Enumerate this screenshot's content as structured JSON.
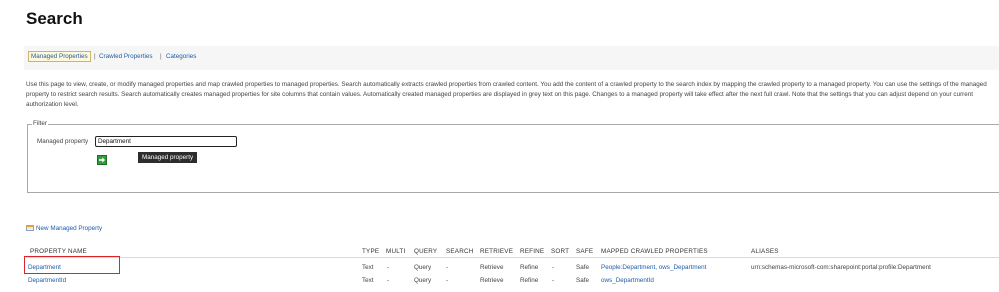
{
  "page": {
    "title": "Search"
  },
  "tabs": [
    {
      "label": "Managed Properties",
      "selected": true
    },
    {
      "label": "Crawled Properties",
      "selected": false
    },
    {
      "label": "Categories",
      "selected": false
    }
  ],
  "tab_separator": "|",
  "description": "Use this page to view, create, or modify managed properties and map crawled properties to managed properties. Search automatically extracts crawled properties from crawled content. You add the content of a crawled property to the search index by mapping the crawled property to a managed property. You can use the settings of the managed property to restrict search results. Search automatically creates managed properties for site columns that contain values. Automatically created managed properties are displayed in grey text on this page. Changes to a managed property will take effect after the next full crawl. Note that the settings that you can adjust depend on your current authorization level.",
  "filter": {
    "legend": "Filter",
    "label": "Managed property",
    "value": "Department",
    "tooltip": "Managed property",
    "go_icon": "arrow-right-icon"
  },
  "new_property_link": {
    "label": "New Managed Property",
    "icon": "new-item-icon"
  },
  "table": {
    "headers": {
      "name": "PROPERTY NAME",
      "type": "TYPE",
      "multi": "MULTI",
      "query": "QUERY",
      "search": "SEARCH",
      "retrieve": "RETRIEVE",
      "refine": "REFINE",
      "sort": "SORT",
      "safe": "SAFE",
      "mapped": "MAPPED CRAWLED PROPERTIES",
      "aliases": "ALIASES"
    },
    "rows": [
      {
        "name": "Department",
        "type": "Text",
        "multi": "-",
        "query": "Query",
        "search": "-",
        "retrieve": "Retrieve",
        "refine": "Refine",
        "sort": "-",
        "safe": "Safe",
        "mapped": "People:Department, ows_Department",
        "aliases": "urn:schemas-microsoft-com:sharepoint:portal:profile:Department",
        "highlighted": true
      },
      {
        "name": "DepartmentId",
        "type": "Text",
        "multi": "-",
        "query": "Query",
        "search": "-",
        "retrieve": "Retrieve",
        "refine": "Refine",
        "sort": "-",
        "safe": "Safe",
        "mapped": "ows_DepartmentId",
        "aliases": "",
        "highlighted": false
      }
    ]
  },
  "colors": {
    "link": "#1e5da8",
    "highlight": "#d9262b",
    "selected_tab_bg": "#fff8da"
  }
}
